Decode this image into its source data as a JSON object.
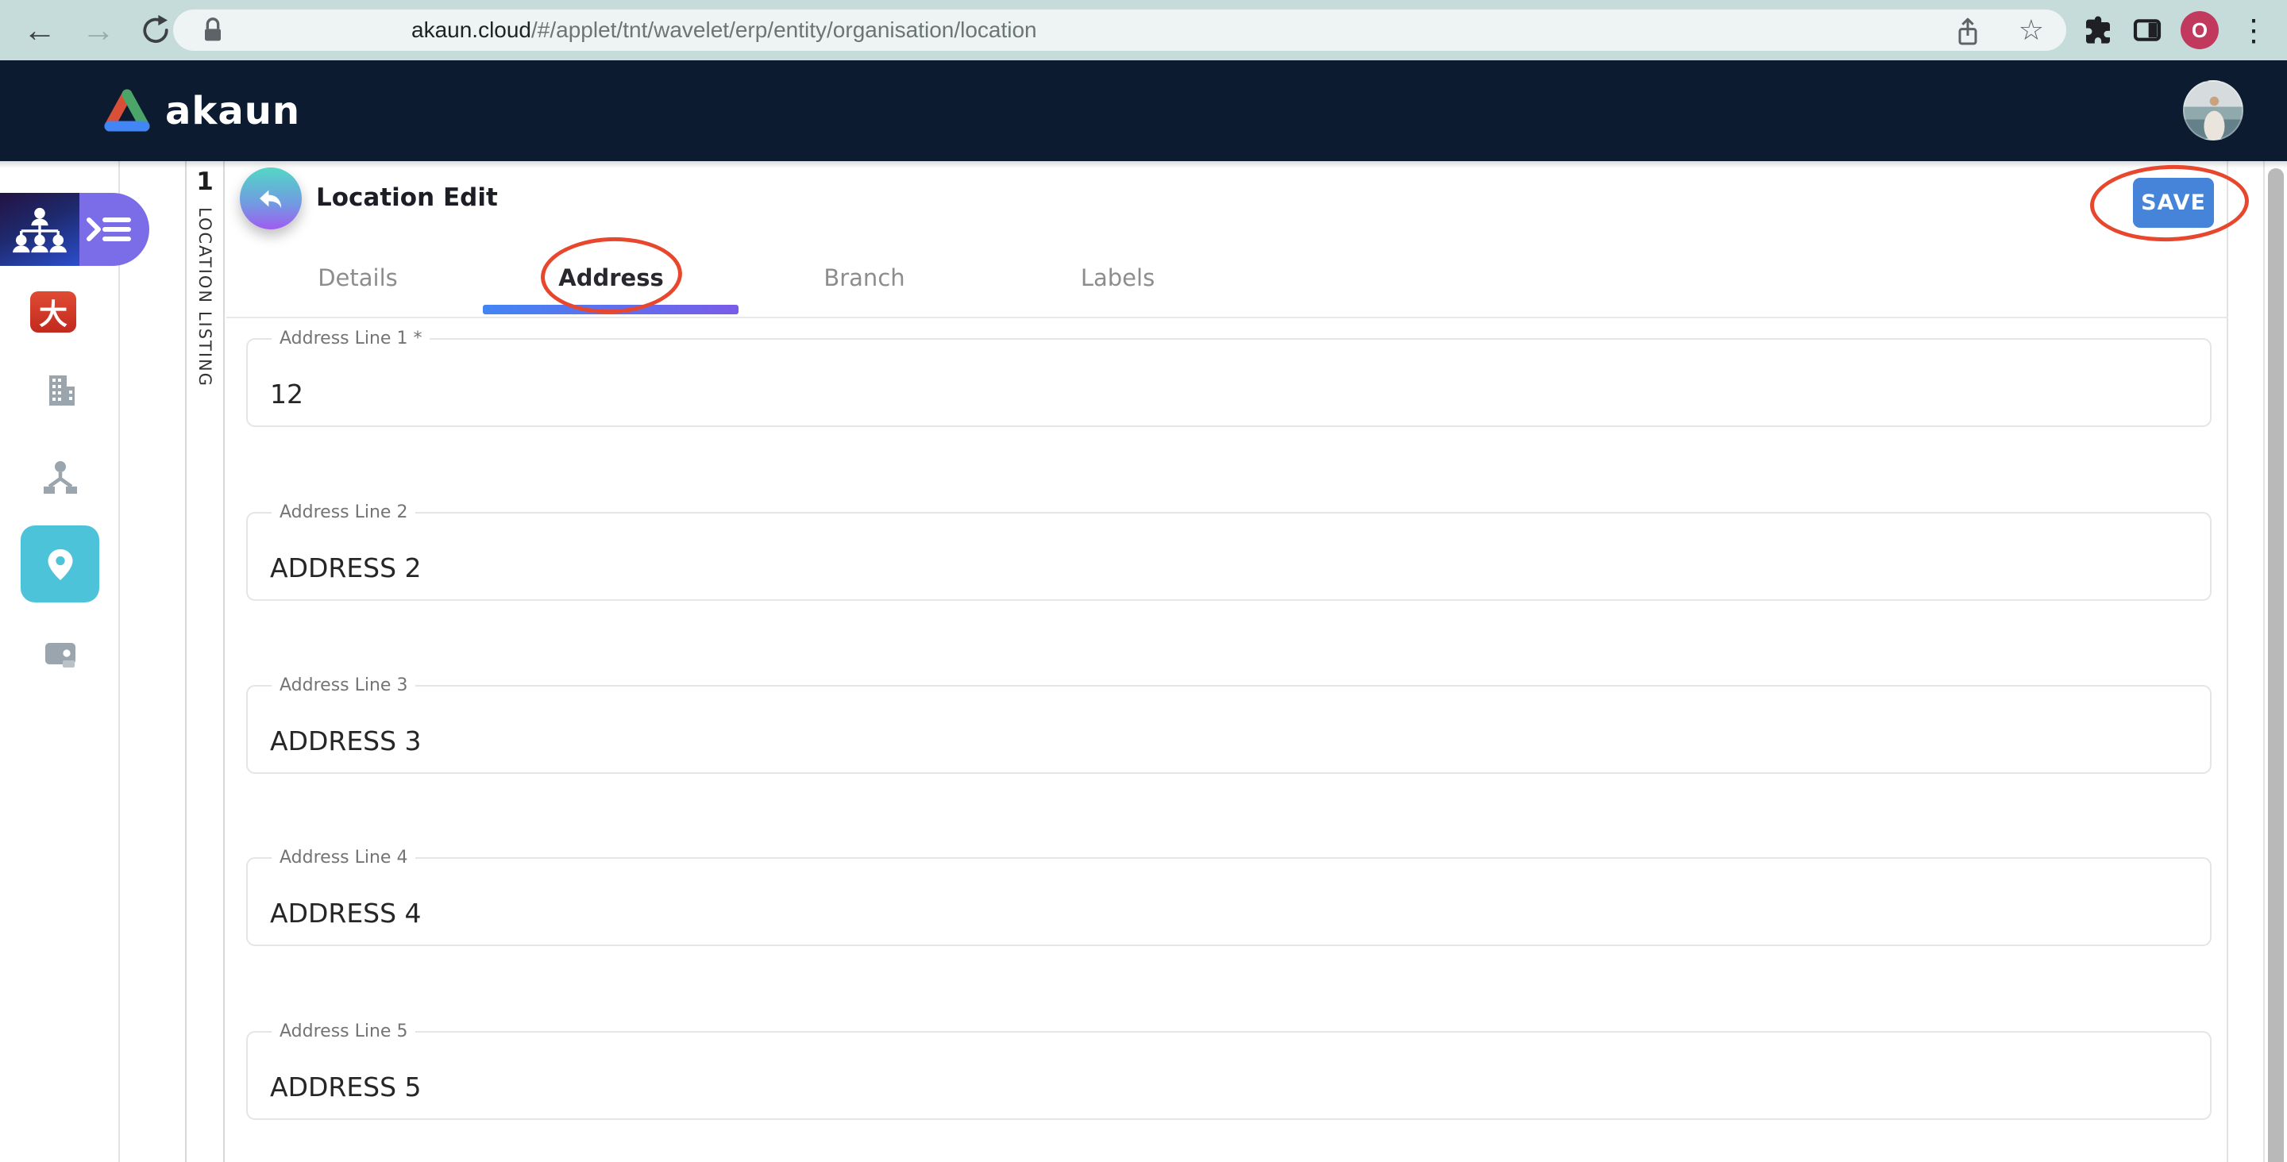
{
  "browser": {
    "back_glyph": "←",
    "forward_glyph": "→",
    "star_glyph": "☆",
    "menu_glyph": "⋮",
    "url": {
      "host": "akaun.cloud",
      "path": "/#/applet/tnt/wavelet/erp/entity/organisation/location"
    },
    "profile_initial": "O"
  },
  "app_header": {
    "logo_text": "akaun"
  },
  "sidebar": {
    "items": [
      {
        "id": "organisation-applet",
        "icon": "org-chart-icon",
        "state": "active-applet"
      },
      {
        "id": "red-app",
        "icon": "dai-glyph-icon",
        "glyph": "大"
      },
      {
        "id": "entity",
        "icon": "building-icon"
      },
      {
        "id": "hierarchy",
        "icon": "sitemap-icon"
      },
      {
        "id": "location",
        "icon": "location-pin-icon",
        "state": "selected"
      },
      {
        "id": "wallet",
        "icon": "wallet-icon"
      }
    ]
  },
  "rail": {
    "badge": "1",
    "label": "LOCATION LISTING"
  },
  "page": {
    "title": "Location Edit",
    "save_button": "SAVE",
    "tabs": [
      {
        "label": "Details",
        "active": false
      },
      {
        "label": "Address",
        "active": true
      },
      {
        "label": "Branch",
        "active": false
      },
      {
        "label": "Labels",
        "active": false
      }
    ]
  },
  "form": {
    "fields": [
      {
        "label": "Address Line 1 *",
        "value": "12"
      },
      {
        "label": "Address Line 2",
        "value": "ADDRESS 2"
      },
      {
        "label": "Address Line 3",
        "value": "ADDRESS 3"
      },
      {
        "label": "Address Line 4",
        "value": "ADDRESS 4"
      },
      {
        "label": "Address Line 5",
        "value": "ADDRESS 5"
      }
    ]
  },
  "annotations": {
    "color": "#e8472e",
    "items": [
      "address-tab-circle",
      "save-button-circle"
    ]
  },
  "colors": {
    "browser_bar": "#c5dcdb",
    "header_navy": "#0d1b30",
    "accent_blue": "#4584d9",
    "tab_gradient_start": "#4285f4",
    "tab_gradient_end": "#7a5be8",
    "sidebar_active_teal": "#4cc3d9",
    "applet_pill_purple": "#7b6ce8",
    "annotation_red": "#e8472e"
  }
}
